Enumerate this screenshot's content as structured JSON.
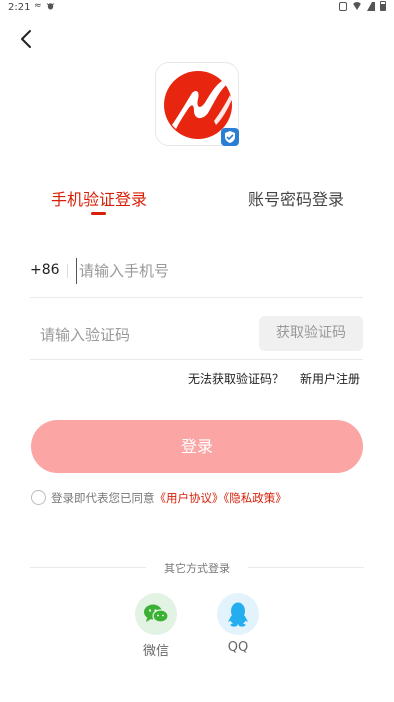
{
  "status_bar": {
    "time": "2:21",
    "left_icons": [
      "tethering-icon",
      "bug-icon"
    ],
    "right_icons": [
      "vibrate-icon",
      "wifi-icon",
      "signal-icon",
      "battery-icon"
    ]
  },
  "header": {
    "back_icon": "back-arrow-icon"
  },
  "logo": {
    "icon": "app-logo-icon",
    "badge_icon": "shield-badge-icon",
    "colors": {
      "red": "#e8260f",
      "badge": "#2a7fd4"
    }
  },
  "tabs": [
    {
      "label": "手机验证登录",
      "active": true
    },
    {
      "label": "账号密码登录",
      "active": false
    }
  ],
  "phone": {
    "country_code": "+86",
    "placeholder": "请输入手机号",
    "value": ""
  },
  "code": {
    "placeholder": "请输入验证码",
    "value": "",
    "get_code_label": "获取验证码"
  },
  "links": {
    "cant_get_code": "无法获取验证码？",
    "register": "新用户注册"
  },
  "login_button": {
    "label": "登录",
    "color": "#fba5a5"
  },
  "agreement": {
    "checked": false,
    "prefix": "登录即代表您已同意",
    "user_agreement": "《用户协议》",
    "privacy_policy": "《隐私政策》"
  },
  "other_login": {
    "label": "其它方式登录",
    "options": [
      {
        "label": "微信",
        "icon": "wechat-icon",
        "color": "#3cb034"
      },
      {
        "label": "QQ",
        "icon": "qq-icon",
        "color": "#24aef0"
      }
    ]
  },
  "accent_color": "#d81e06"
}
